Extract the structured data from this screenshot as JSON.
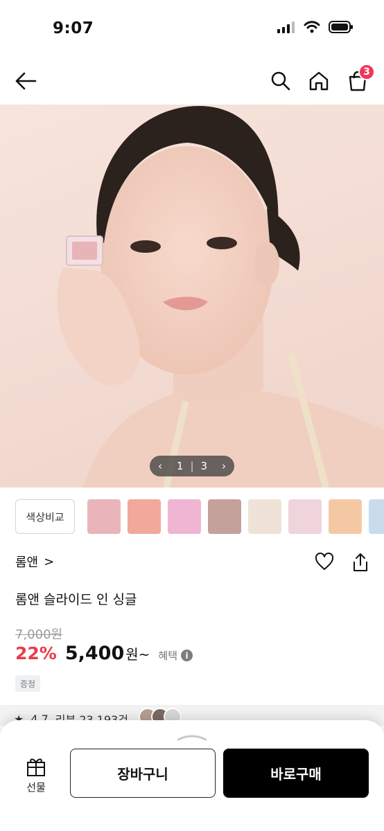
{
  "status_bar": {
    "time": "9:07"
  },
  "header": {
    "cart_count": "3"
  },
  "hero": {
    "pager_current": "1",
    "pager_total": "3"
  },
  "compare_label": "색상비교",
  "swatches": [
    "#e9b5ba",
    "#f2a89b",
    "#f0b5d2",
    "#c4a19a",
    "#efe3d7",
    "#efd4dc",
    "#f5c8a4",
    "#c9dcec"
  ],
  "product": {
    "brand": "롬앤",
    "brand_chevron": ">",
    "title": "롬앤 슬라이드 인 싱글",
    "original_price": "7,000원",
    "discount": "22%",
    "price": "5,400",
    "price_unit": "원~",
    "benefit_label": "혜택",
    "info_icon_text": "i",
    "gift_tag": "증정"
  },
  "rating": {
    "score": "4.7",
    "review_label": "리뷰 23,193건",
    "star": "★"
  },
  "bottom_bar": {
    "gift_label": "선물",
    "cart_label": "장바구니",
    "buy_label": "바로구매"
  }
}
